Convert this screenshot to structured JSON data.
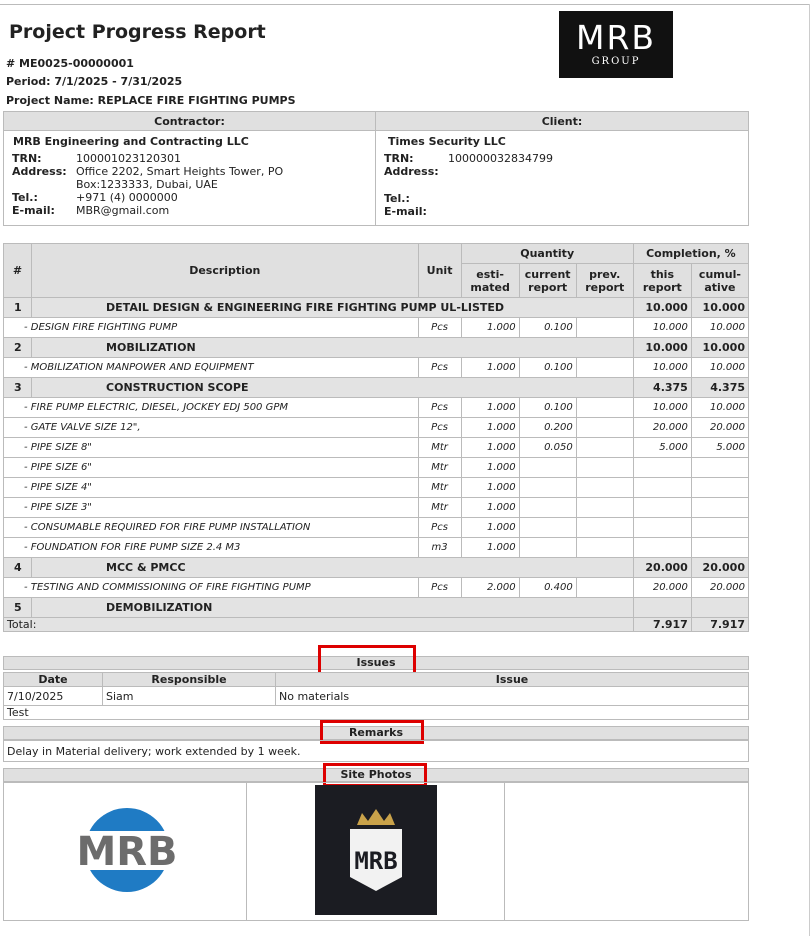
{
  "header": {
    "title": "Project Progress Report",
    "number": "# ME0025-00000001",
    "period": "Period: 7/1/2025 - 7/31/2025",
    "project_name": "Project Name: REPLACE FIRE FIGHTING PUMPS",
    "logo_main": "MRB",
    "logo_sub": "GROUP"
  },
  "contractor": {
    "heading": "Contractor:",
    "name": "MRB Engineering and Contracting LLC",
    "trn_label": "TRN:",
    "trn": "100001023120301",
    "address_label": "Address:",
    "address": "Office 2202, Smart Heights Tower, PO Box:1233333, Dubai, UAE",
    "tel_label": "Tel.:",
    "tel": "+971 (4) 0000000",
    "email_label": "E-mail:",
    "email": "MBR@gmail.com"
  },
  "client": {
    "heading": "Client:",
    "name": "Times Security LLC",
    "trn_label": "TRN:",
    "trn": "100000032834799",
    "address_label": "Address:",
    "tel_label": "Tel.:",
    "email_label": "E-mail:"
  },
  "table_headers": {
    "num": "#",
    "description": "Description",
    "unit": "Unit",
    "quantity": "Quantity",
    "completion": "Completion, %",
    "estimated": "esti-mated",
    "current": "current report",
    "previous": "prev. report",
    "this_report": "this report",
    "cumulative": "cumul-ative"
  },
  "groups": [
    {
      "num": "1",
      "title": "DETAIL DESIGN & ENGINEERING FIRE FIGHTING PUMP UL-LISTED",
      "this": "10.000",
      "cum": "10.000",
      "items": [
        {
          "desc": "- DESIGN FIRE FIGHTING PUMP",
          "unit": "Pcs",
          "est": "1.000",
          "cur": "0.100",
          "prev": "",
          "this": "10.000",
          "cum": "10.000"
        }
      ]
    },
    {
      "num": "2",
      "title": "MOBILIZATION",
      "this": "10.000",
      "cum": "10.000",
      "items": [
        {
          "desc": "- MOBILIZATION MANPOWER AND EQUIPMENT",
          "unit": "Pcs",
          "est": "1.000",
          "cur": "0.100",
          "prev": "",
          "this": "10.000",
          "cum": "10.000"
        }
      ]
    },
    {
      "num": "3",
      "title": "CONSTRUCTION SCOPE",
      "this": "4.375",
      "cum": "4.375",
      "items": [
        {
          "desc": "- FIRE PUMP ELECTRIC, DIESEL, JOCKEY EDJ 500 GPM",
          "unit": "Pcs",
          "est": "1.000",
          "cur": "0.100",
          "prev": "",
          "this": "10.000",
          "cum": "10.000"
        },
        {
          "desc": "- GATE VALVE SIZE 12\",",
          "unit": "Pcs",
          "est": "1.000",
          "cur": "0.200",
          "prev": "",
          "this": "20.000",
          "cum": "20.000"
        },
        {
          "desc": "- PIPE SIZE 8\"",
          "unit": "Mtr",
          "est": "1.000",
          "cur": "0.050",
          "prev": "",
          "this": "5.000",
          "cum": "5.000"
        },
        {
          "desc": "- PIPE SIZE 6\"",
          "unit": "Mtr",
          "est": "1.000",
          "cur": "",
          "prev": "",
          "this": "",
          "cum": ""
        },
        {
          "desc": "- PIPE SIZE 4\"",
          "unit": "Mtr",
          "est": "1.000",
          "cur": "",
          "prev": "",
          "this": "",
          "cum": ""
        },
        {
          "desc": "- PIPE SIZE 3\"",
          "unit": "Mtr",
          "est": "1.000",
          "cur": "",
          "prev": "",
          "this": "",
          "cum": ""
        },
        {
          "desc": "- CONSUMABLE REQUIRED FOR FIRE PUMP INSTALLATION",
          "unit": "Pcs",
          "est": "1.000",
          "cur": "",
          "prev": "",
          "this": "",
          "cum": ""
        },
        {
          "desc": "- FOUNDATION FOR FIRE PUMP SIZE 2.4 M3",
          "unit": "m3",
          "est": "1.000",
          "cur": "",
          "prev": "",
          "this": "",
          "cum": ""
        }
      ]
    },
    {
      "num": "4",
      "title": "MCC & PMCC",
      "this": "20.000",
      "cum": "20.000",
      "items": [
        {
          "desc": "- TESTING AND COMMISSIONING OF FIRE FIGHTING PUMP",
          "unit": "Pcs",
          "est": "2.000",
          "cur": "0.400",
          "prev": "",
          "this": "20.000",
          "cum": "20.000"
        }
      ]
    },
    {
      "num": "5",
      "title": "DEMOBILIZATION",
      "this": "",
      "cum": "",
      "items": []
    }
  ],
  "total": {
    "label": "Total:",
    "this": "7.917",
    "cum": "7.917"
  },
  "issues": {
    "heading": "Issues",
    "col_date": "Date",
    "col_responsible": "Responsible",
    "col_issue": "Issue",
    "rows": [
      {
        "date": "7/10/2025",
        "responsible": "Siam",
        "issue": "No materials"
      }
    ],
    "note": "Test"
  },
  "remarks": {
    "heading": "Remarks",
    "text": "Delay in Material delivery; work extended by 1 week."
  },
  "photos": {
    "heading": "Site Photos",
    "photo1_text": "MRB",
    "photo2_text": "MRB",
    "colors": {
      "photo1_blue": "#1f7bc4",
      "photo2_bg": "#1b1c22",
      "crown": "#c9a24a"
    }
  },
  "colors": {
    "highlight": "#dd0000",
    "header_bg": "#e0e0e0"
  }
}
